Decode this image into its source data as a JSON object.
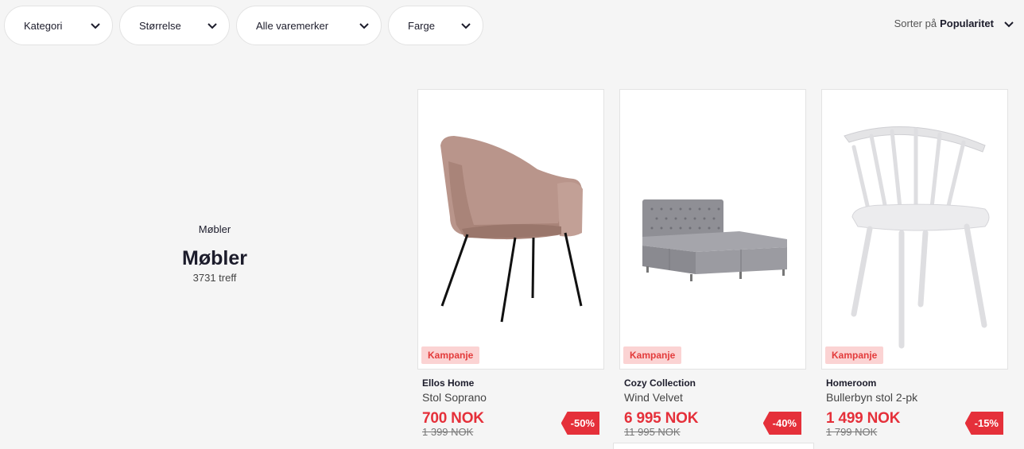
{
  "filters": [
    {
      "label": "Kategori"
    },
    {
      "label": "Størrelse"
    },
    {
      "label": "Alle varemerker"
    },
    {
      "label": "Farge"
    }
  ],
  "sort": {
    "prefix": "Sorter på",
    "value": "Popularitet"
  },
  "category": {
    "breadcrumb": "Møbler",
    "title": "Møbler",
    "count": "3731 treff"
  },
  "products": [
    {
      "brand": "Ellos Home",
      "name": "Stol Soprano",
      "price": "700 NOK",
      "old_price": "1 399 NOK",
      "discount": "-50%",
      "badge": "Kampanje"
    },
    {
      "brand": "Cozy Collection",
      "name": "Wind Velvet",
      "price": "6 995 NOK",
      "old_price": "11 995 NOK",
      "discount": "-40%",
      "badge": "Kampanje"
    },
    {
      "brand": "Homeroom",
      "name": "Bullerbyn stol 2-pk",
      "price": "1 499 NOK",
      "old_price": "1 799 NOK",
      "discount": "-15%",
      "badge": "Kampanje"
    }
  ],
  "colors": {
    "accent": "#e5303a",
    "badge_bg": "#fbd3d3",
    "page_bg": "#f5f5f5"
  }
}
